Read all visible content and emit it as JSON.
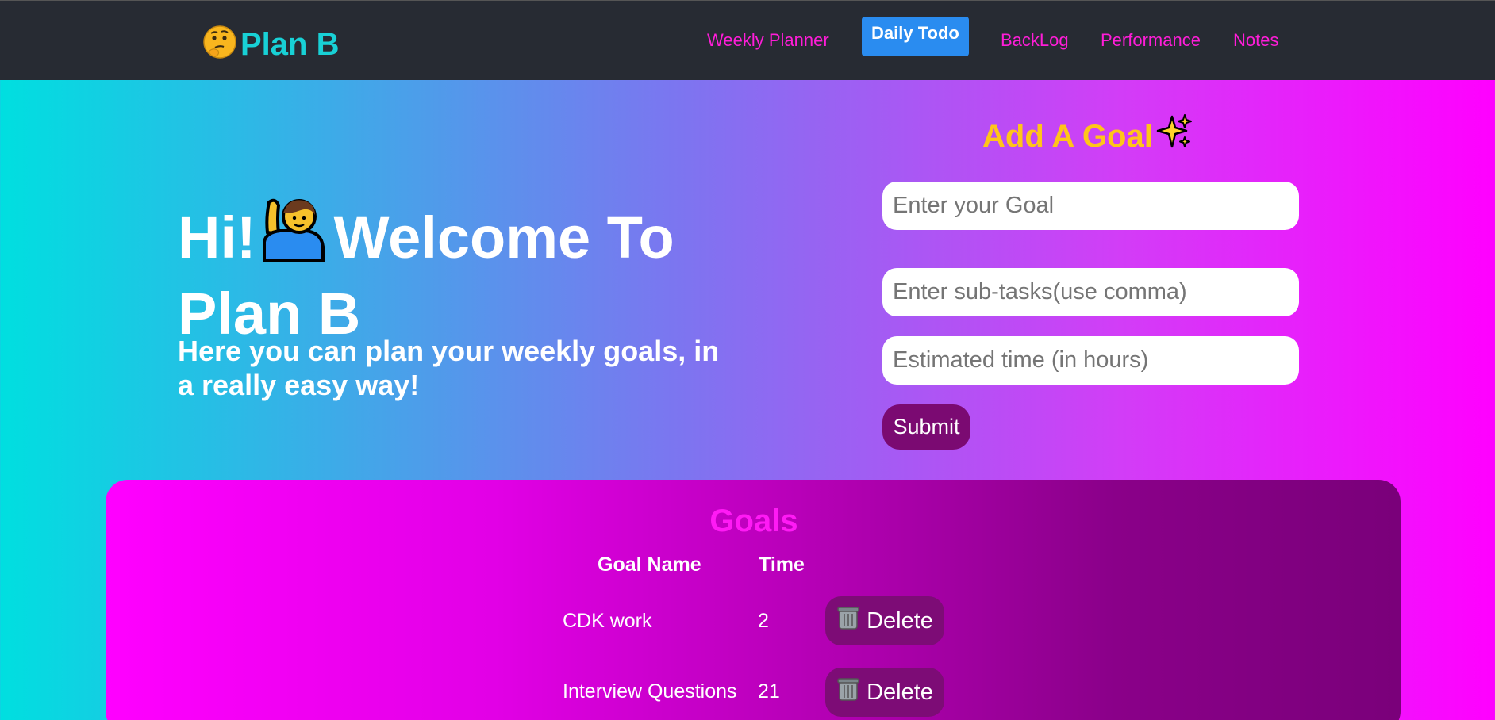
{
  "app": {
    "brand": "Plan B",
    "brand_icon": "thinking-face-icon"
  },
  "nav": {
    "items": [
      {
        "label": "Weekly Planner",
        "active": false
      },
      {
        "label": "Daily Todo",
        "active": true
      },
      {
        "label": "BackLog",
        "active": false
      },
      {
        "label": "Performance",
        "active": false
      },
      {
        "label": "Notes",
        "active": false
      }
    ]
  },
  "hero": {
    "title_part1": "Hi!",
    "title_part2": "Welcome To Plan B",
    "title_icon": "person-raising-hand-icon",
    "subtitle": "Here you can plan your weekly goals, in a really easy way!"
  },
  "form": {
    "title": "Add A Goal",
    "title_icon": "sparkles-icon",
    "goal_placeholder": "Enter your Goal",
    "subtasks_placeholder": "Enter sub-tasks(use comma)",
    "time_placeholder": "Estimated time (in hours)",
    "submit_label": "Submit"
  },
  "goals": {
    "title": "Goals",
    "columns": [
      "Goal Name",
      "Time"
    ],
    "rows": [
      {
        "name": "CDK work",
        "time": "2",
        "delete_label": "Delete"
      },
      {
        "name": "Interview Questions",
        "time": "21",
        "delete_label": "Delete"
      }
    ],
    "delete_icon": "wastebasket-icon"
  },
  "colors": {
    "navbar_bg": "#272b33",
    "brand": "#18d1d6",
    "nav_link": "#ff1dd8",
    "nav_active_bg": "#2a8cf0",
    "form_title": "#ffc41a",
    "submit_bg": "#7b0a72",
    "goals_title": "#ff1af5",
    "delete_bg": "#7d0c76"
  }
}
